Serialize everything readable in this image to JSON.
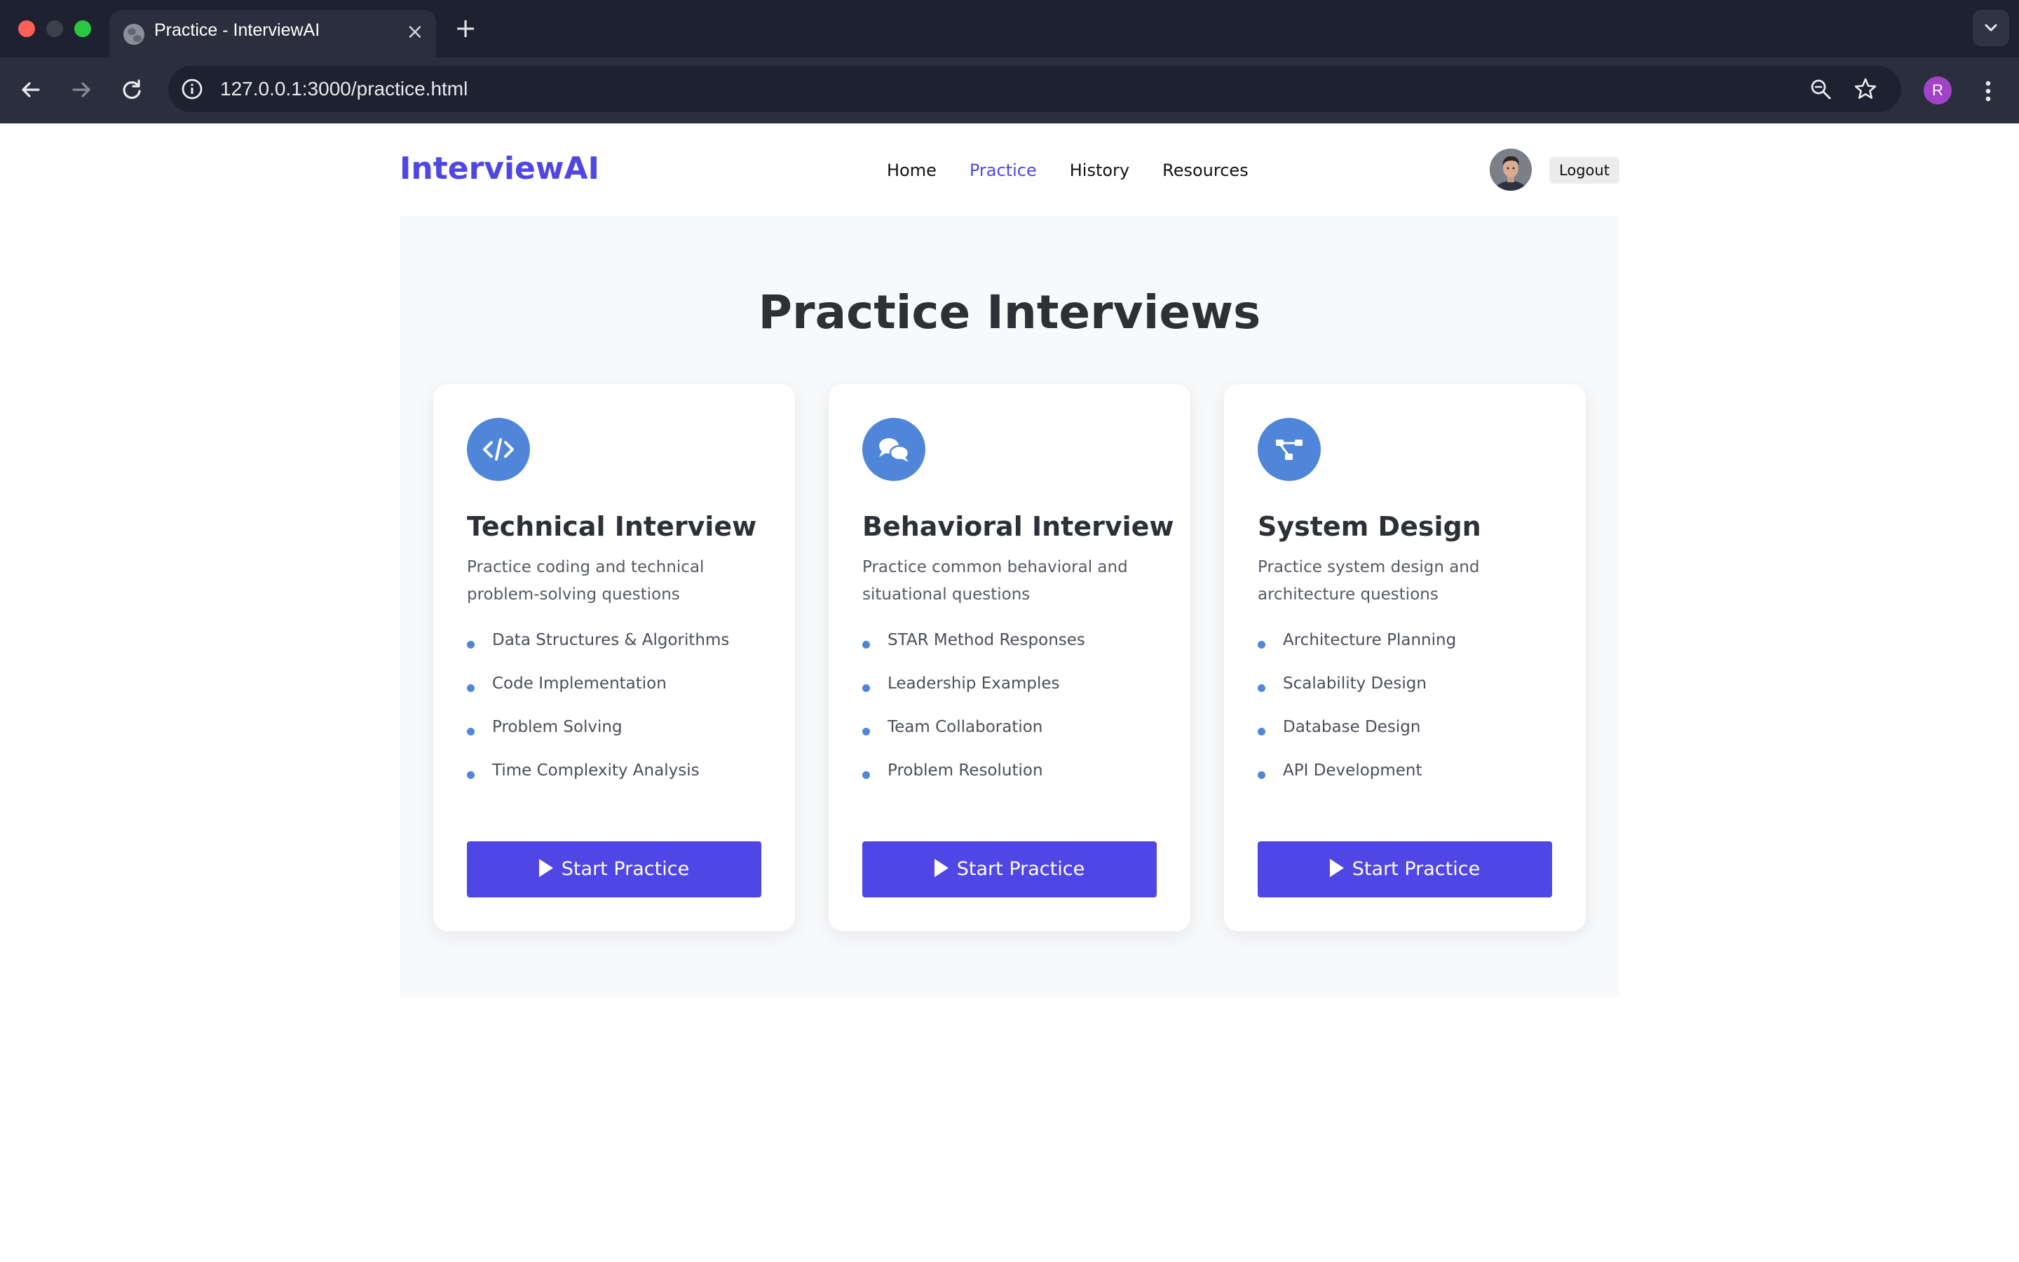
{
  "browser": {
    "tab_title": "Practice - InterviewAI",
    "tab_close": "×",
    "new_tab": "+",
    "url": "127.0.0.1:3000/practice.html",
    "profile_initial": "R"
  },
  "navbar": {
    "logo": "InterviewAI",
    "links": [
      {
        "label": "Home",
        "active": false
      },
      {
        "label": "Practice",
        "active": true
      },
      {
        "label": "History",
        "active": false
      },
      {
        "label": "Resources",
        "active": false
      }
    ],
    "logout_label": "Logout"
  },
  "main": {
    "title": "Practice Interviews",
    "cards": [
      {
        "icon": "code-icon",
        "title": "Technical Interview",
        "description": "Practice coding and technical problem-solving questions",
        "items": [
          "Data Structures & Algorithms",
          "Code Implementation",
          "Problem Solving",
          "Time Complexity Analysis"
        ],
        "button_label": "Start Practice"
      },
      {
        "icon": "chat-bubbles-icon",
        "title": "Behavioral Interview",
        "description": "Practice common behavioral and situational questions",
        "items": [
          "STAR Method Responses",
          "Leadership Examples",
          "Team Collaboration",
          "Problem Resolution"
        ],
        "button_label": "Start Practice"
      },
      {
        "icon": "sitemap-icon",
        "title": "System Design",
        "description": "Practice system design and architecture questions",
        "items": [
          "Architecture Planning",
          "Scalability Design",
          "Database Design",
          "API Development"
        ],
        "button_label": "Start Practice"
      }
    ]
  },
  "colors": {
    "brand": "#4f46e5",
    "icon_circle": "#4f86d9",
    "heading": "#2d3035",
    "section_bg": "#f8f9fa"
  }
}
